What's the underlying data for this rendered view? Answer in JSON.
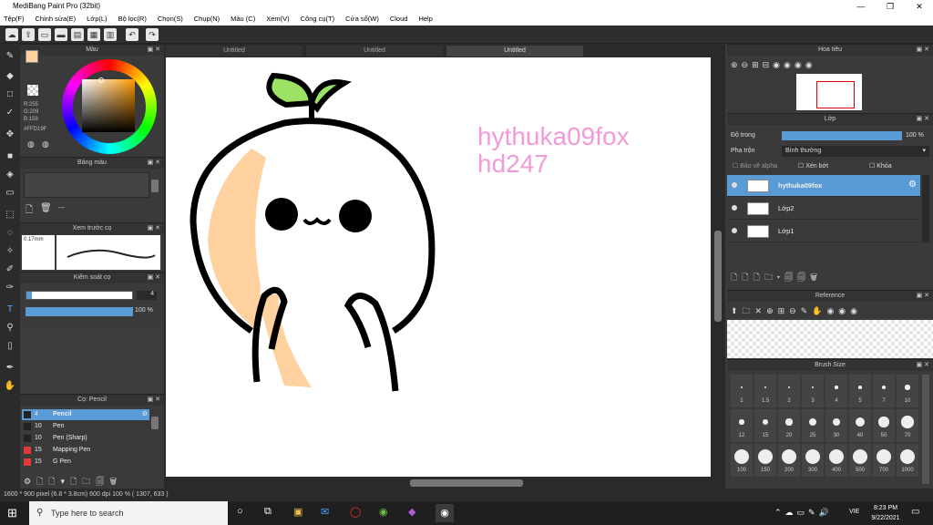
{
  "window": {
    "title": "MediBang Paint Pro (32bit)",
    "min": "—",
    "max": "❐",
    "close": "✕"
  },
  "menu": [
    "Tệp(F)",
    "Chỉnh sửa(E)",
    "Lớp(L)",
    "Bộ lọc(R)",
    "Chọn(S)",
    "Chụp(N)",
    "Màu (C)",
    "Xem(V)",
    "Công cụ(T)",
    "Cửa sổ(W)",
    "Cloud",
    "Help"
  ],
  "tabs": [
    "Untitled",
    "Untitled",
    "Untitled"
  ],
  "color_panel": {
    "title": "Màu",
    "r": "R:255",
    "g": "G:209",
    "b": "B:159",
    "hex": "#FFD19F",
    "fg": "#FFD19F"
  },
  "palette_panel": {
    "title": "Bảng màu",
    "dash": "---"
  },
  "preview_panel": {
    "title": "Xem trước cọ",
    "size": "0.17mm"
  },
  "brush_control": {
    "title": "Kiểm soát cọ",
    "size": "4",
    "opacity": "100 %",
    "opacity_value": 1.0
  },
  "brush_list": {
    "title": "Cọ: Pencil",
    "items": [
      {
        "size": "4",
        "name": "Pencil",
        "color": "#222222",
        "selected": true
      },
      {
        "size": "10",
        "name": "Pen",
        "color": "#222222",
        "selected": false
      },
      {
        "size": "10",
        "name": "Pen (Sharp)",
        "color": "#222222",
        "selected": false
      },
      {
        "size": "15",
        "name": "Mapping Pen",
        "color": "#e03a3a",
        "selected": false
      },
      {
        "size": "15",
        "name": "G Pen",
        "color": "#e03a3a",
        "selected": false
      }
    ]
  },
  "navigator": {
    "title": "Hoa tiêu"
  },
  "layers_panel": {
    "title": "Lớp",
    "opacity_label": "Độ trong",
    "opacity": "100 %",
    "opacity_value": 1.0,
    "blend_label": "Pha trộn",
    "blend": "Bình thường",
    "protect_alpha": "Bảo vệ alpha",
    "clipping": "Xén bớt",
    "lock": "Khóa",
    "layers": [
      {
        "name": "hythuka09fox",
        "selected": true
      },
      {
        "name": "Lớp2",
        "selected": false
      },
      {
        "name": "Lớp1",
        "selected": false
      }
    ]
  },
  "reference_panel": {
    "title": "Reference"
  },
  "brush_size_panel": {
    "title": "Brush Size",
    "sizes": [
      "1",
      "1.5",
      "2",
      "3",
      "4",
      "5",
      "7",
      "10",
      "12",
      "15",
      "20",
      "25",
      "30",
      "40",
      "50",
      "70",
      "100",
      "150",
      "200",
      "300",
      "400",
      "500",
      "700",
      "1000"
    ]
  },
  "canvas_text": {
    "line1": "hythuka09fox",
    "line2": "hd247",
    "color": "#f29ad8"
  },
  "statusbar": "1600 * 900 pixel   (6.8 * 3.8cm)   600 dpi   100 %   ( 1307, 633 )",
  "taskbar": {
    "search_placeholder": "Type here to search",
    "time": "8:23 PM",
    "date": "9/22/2021",
    "lang": "VIE"
  }
}
